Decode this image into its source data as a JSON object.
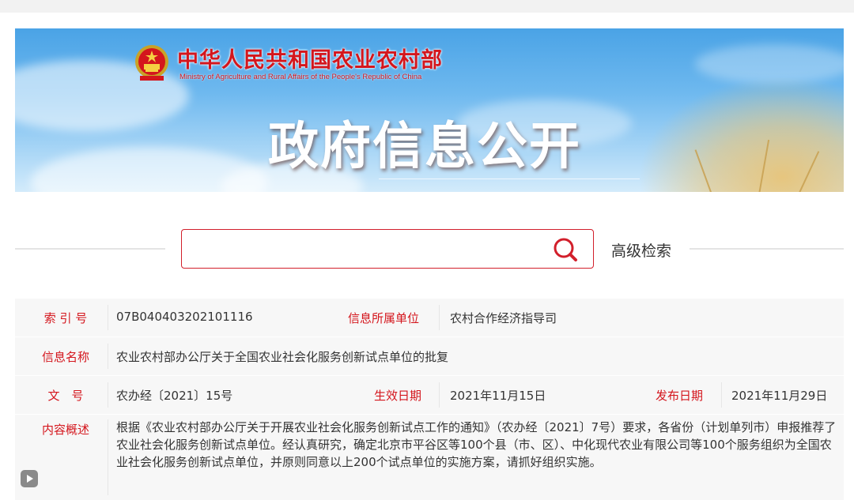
{
  "banner": {
    "ministry_cn": "中华人民共和国农业农村部",
    "ministry_en": "Ministry of Agriculture and Rural Affairs of the People's Republic of China",
    "title": "政府信息公开",
    "emblem_icon": "national-emblem-icon"
  },
  "search": {
    "placeholder": "",
    "value": "",
    "icon": "search-icon",
    "advanced_label": "高级检索"
  },
  "info": {
    "index_label": "索 引 号",
    "index_value": "07B040403202101116",
    "unit_label": "信息所属单位",
    "unit_value": "农村合作经济指导司",
    "name_label": "信息名称",
    "name_value": "农业农村部办公厅关于全国农业社会化服务创新试点单位的批复",
    "doc_label": "文　号",
    "doc_value": "农办经〔2021〕15号",
    "effective_label": "生效日期",
    "effective_value": "2021年11月15日",
    "publish_label": "发布日期",
    "publish_value": "2021年11月29日",
    "summary_label": "内容概述",
    "summary_value": "根据《农业农村部办公厅关于开展农业社会化服务创新试点工作的通知》（农办经〔2021〕7号）要求，各省份（计划单列市）申报推荐了农业社会化服务创新试点单位。经认真研究，确定北京市平谷区等100个县（市、区）、中化现代农业有限公司等100个服务组织为全国农业社会化服务创新试点单位，并原则同意以上200个试点单位的实施方案，请抓好组织实施。"
  },
  "colors": {
    "accent_red": "#d4161d",
    "label_bg": "#f7f7f7",
    "sky_blue": "#4aa3e6"
  },
  "play_icon": "play-icon"
}
